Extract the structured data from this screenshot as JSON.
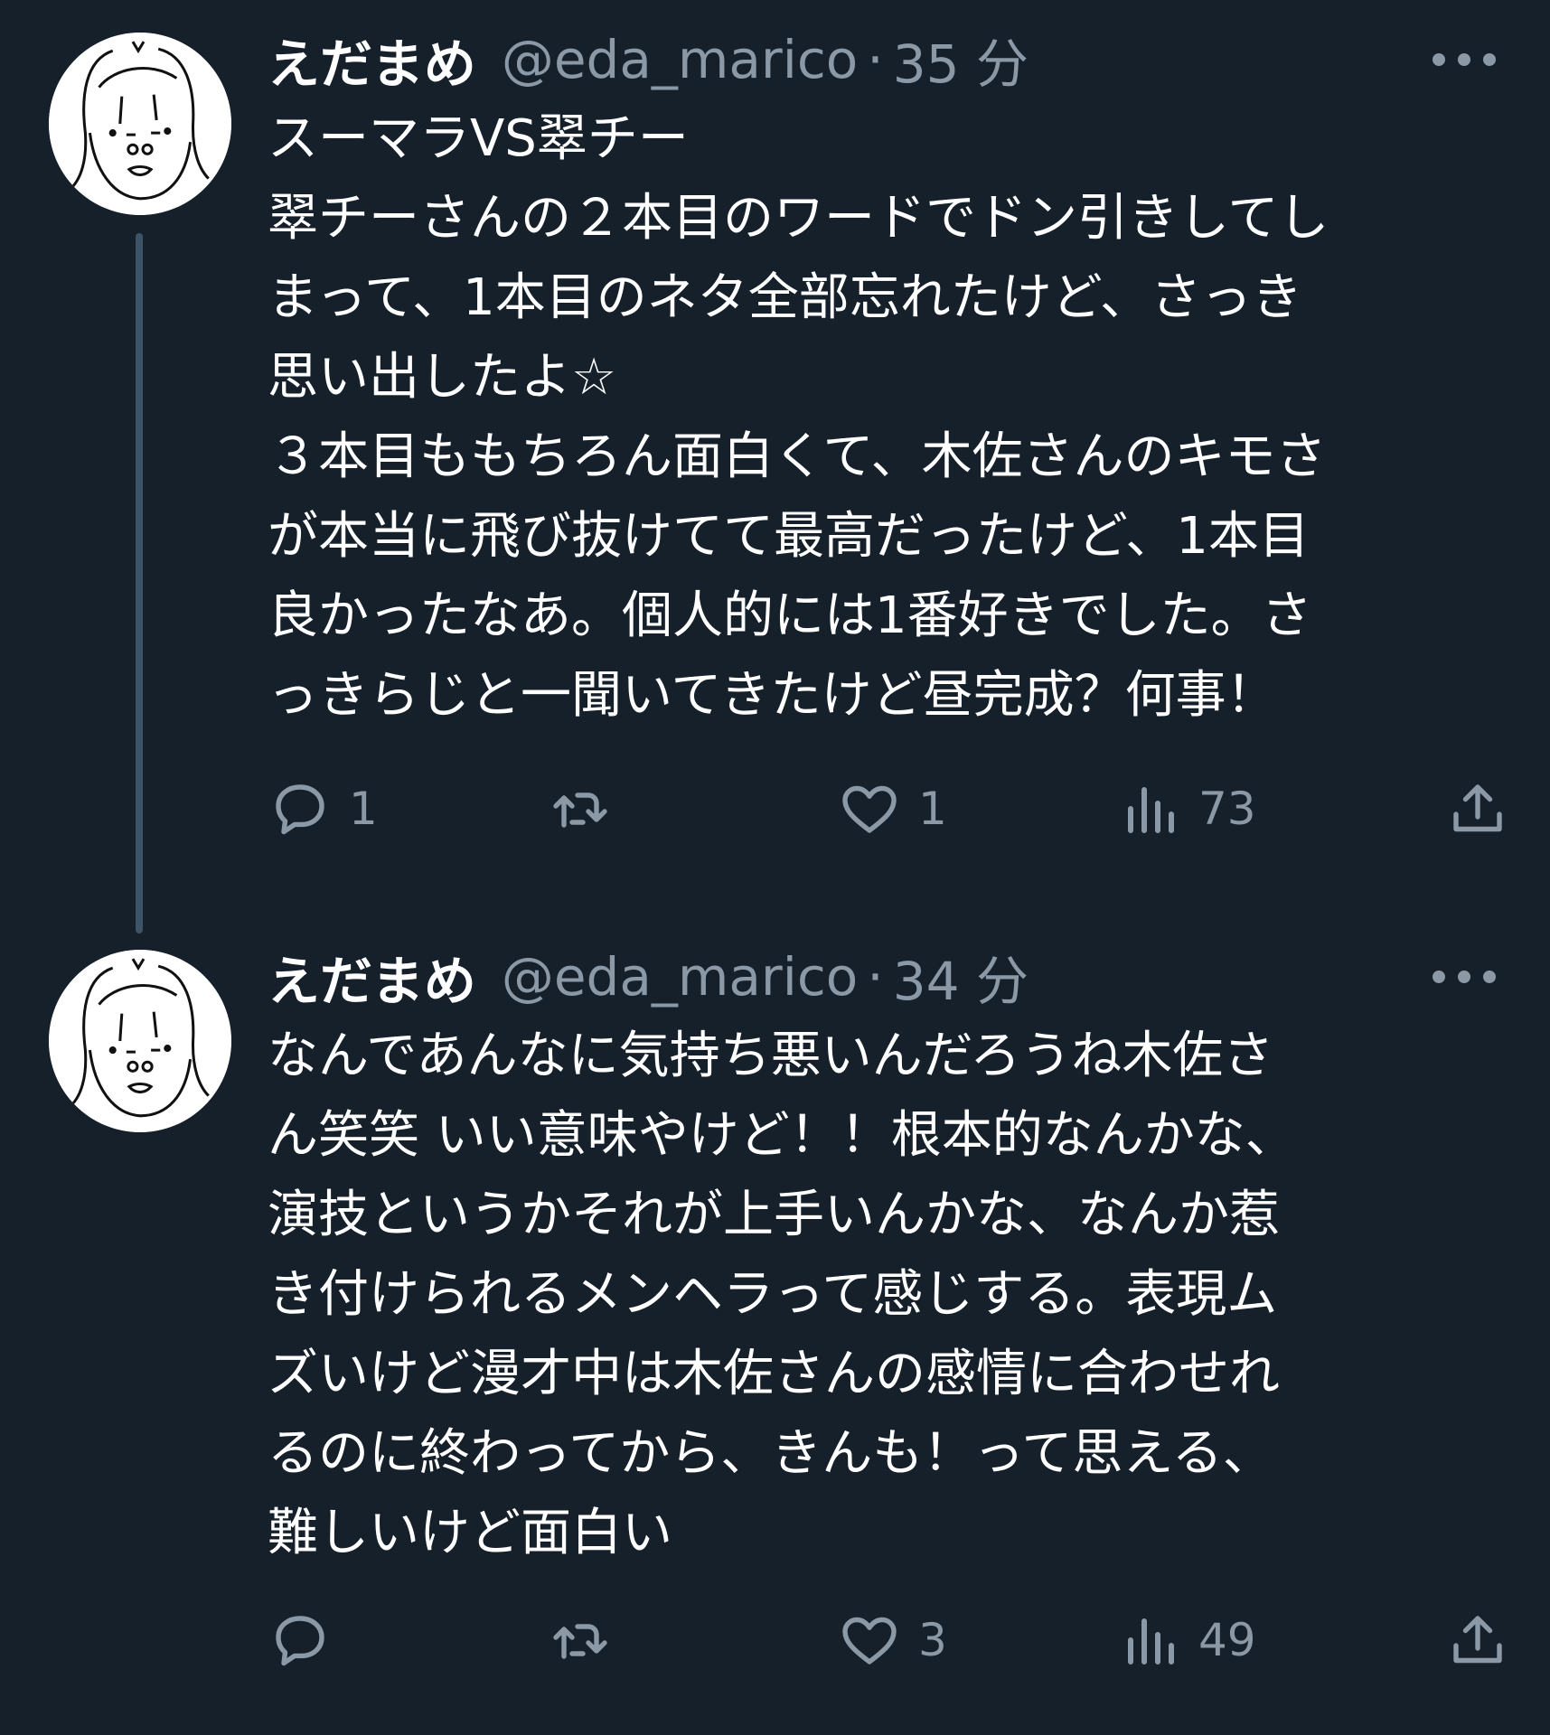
{
  "tweets": [
    {
      "display_name": "えだまめ",
      "handle": "@eda_marico",
      "separator": "·",
      "time": "35 分",
      "text_lines": [
        "スーマラVS翠チー",
        "翠チーさんの２本目のワードでドン引きしてし",
        "まって、1本目のネタ全部忘れたけど、さっき",
        "思い出したよ☆",
        "３本目ももちろん面白くて、木佐さんのキモさ",
        "が本当に飛び抜けてて最高だったけど、1本目",
        "良かったなあ。個人的には1番好きでした。さ",
        "っきらじと一聞いてきたけど昼完成？何事！"
      ],
      "reply_count": "1",
      "retweet_count": "",
      "like_count": "1",
      "view_count": "73"
    },
    {
      "display_name": "えだまめ",
      "handle": "@eda_marico",
      "separator": "·",
      "time": "34 分",
      "text_lines": [
        "なんであんなに気持ち悪いんだろうね木佐さ",
        "ん笑笑 いい意味やけど！！根本的なんかな、",
        "演技というかそれが上手いんかな、なんか惹",
        "き付けられるメンヘラって感じする。表現ム",
        "ズいけど漫才中は木佐さんの感情に合わせれ",
        "るのに終わってから、きんも！って思える、",
        "難しいけど面白い"
      ],
      "reply_count": "",
      "retweet_count": "",
      "like_count": "3",
      "view_count": "49"
    }
  ],
  "icons": {
    "reply": "reply-icon",
    "retweet": "retweet-icon",
    "like": "heart-icon",
    "views": "views-chart-icon",
    "share": "share-icon",
    "more": "more-dots-icon"
  },
  "colors": {
    "background": "#15202b",
    "text": "#ffffff",
    "secondary": "#8b98a5",
    "thread_line": "#3d5466"
  }
}
